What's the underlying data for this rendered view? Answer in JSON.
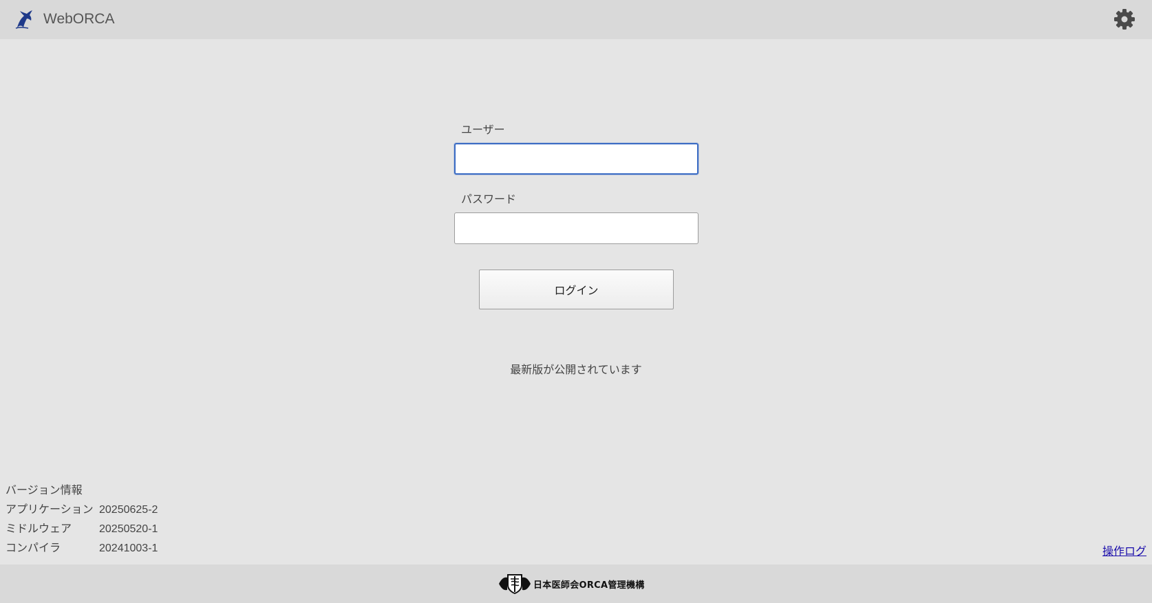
{
  "header": {
    "title": "WebORCA",
    "logo_icon": "orca-whale-logo-icon",
    "settings_icon": "gear-icon"
  },
  "login": {
    "user_label": "ユーザー",
    "user_value": "",
    "password_label": "パスワード",
    "password_value": "",
    "login_button": "ログイン"
  },
  "notice": "最新版が公開されています",
  "version_info": {
    "title": "バージョン情報",
    "rows": [
      {
        "name": "アプリケーション",
        "value": "20250625-2"
      },
      {
        "name": "ミドルウェア",
        "value": "20250520-1"
      },
      {
        "name": "コンパイラ",
        "value": "20241003-1"
      }
    ]
  },
  "operation_log_link": "操作ログ",
  "footer": {
    "org_text": "日本医師会ORCA管理機構"
  },
  "colors": {
    "header_bg": "#d9d9d9",
    "page_bg": "#e5e5e5",
    "focus_border": "#3a6bc4",
    "link": "#1a0dab",
    "logo_blue": "#1f3a8a"
  }
}
